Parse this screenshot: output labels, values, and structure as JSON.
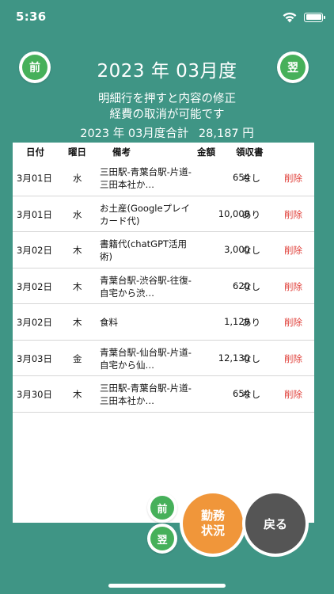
{
  "status_bar": {
    "time": "5:36"
  },
  "nav": {
    "prev_label": "前",
    "next_label": "翌"
  },
  "header": {
    "month_title": "2023 年 03月度",
    "info_line1": "明細行を押すと内容の修正",
    "info_line2": "経費の取消が可能です",
    "total_label": "2023 年 03月度合計",
    "total_value": "28,187 円"
  },
  "table": {
    "columns": [
      "日付",
      "曜日",
      "備考",
      "金額",
      "領収書"
    ],
    "rows": [
      {
        "date": "3月01日",
        "weekday": "水",
        "note": "三田駅-青葉台駅-片道-三田本社か…",
        "amount": "654",
        "receipt": "なし",
        "delete": "削除"
      },
      {
        "date": "3月01日",
        "weekday": "水",
        "note": "お土産(Googleプレイカード代)",
        "amount": "10,000",
        "receipt": "あり",
        "delete": "削除"
      },
      {
        "date": "3月02日",
        "weekday": "木",
        "note": "書籍代(chatGPT活用術)",
        "amount": "3,000",
        "receipt": "なし",
        "delete": "削除"
      },
      {
        "date": "3月02日",
        "weekday": "木",
        "note": "青葉台駅-渋谷駅-往復-自宅から渋…",
        "amount": "620",
        "receipt": "なし",
        "delete": "削除"
      },
      {
        "date": "3月02日",
        "weekday": "木",
        "note": "食料",
        "amount": "1,129",
        "receipt": "あり",
        "delete": "削除"
      },
      {
        "date": "3月03日",
        "weekday": "金",
        "note": "青葉台駅-仙台駅-片道-自宅から仙…",
        "amount": "12,130",
        "receipt": "なし",
        "delete": "削除"
      },
      {
        "date": "3月30日",
        "weekday": "木",
        "note": "三田駅-青葉台駅-片道-三田本社か…",
        "amount": "654",
        "receipt": "なし",
        "delete": "削除"
      }
    ]
  },
  "actions": {
    "work_status_line1": "勤務",
    "work_status_line2": "状況",
    "back_label": "戻る"
  },
  "colors": {
    "background": "#3f9585",
    "nav_green": "#46b05a",
    "work_orange": "#f0963a",
    "back_gray": "#555555",
    "delete_red": "#e0403a"
  }
}
